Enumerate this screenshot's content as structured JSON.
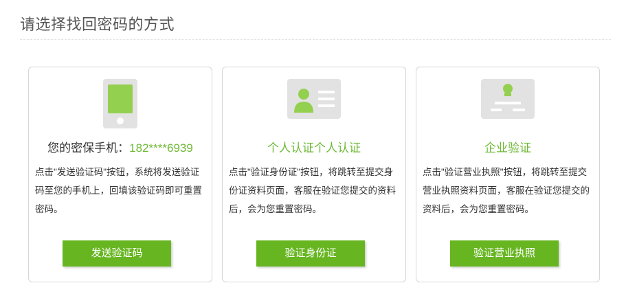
{
  "page": {
    "title": "请选择找回密码的方式"
  },
  "cards": [
    {
      "icon": "mobile-phone-icon",
      "heading_prefix": "您的密保手机：",
      "heading_value": "182****6939",
      "description": "点击\"发送验证码\"按钮，系统将发送验证码至您的手机上，回填该验证码即可重置密码。",
      "button_label": "发送验证码"
    },
    {
      "icon": "id-card-icon",
      "heading": "个人认证个人认证",
      "description": "点击\"验证身份证\"按钮，将跳转至提交身份证资料页面，客服在验证您提交的资料后，会为您重置密码。",
      "button_label": "验证身份证"
    },
    {
      "icon": "business-license-icon",
      "heading": "企业验证",
      "description": "点击\"验证营业执照\"按钮，将跳转至提交营业执照资料页面，客服在验证您提交的资料后，会为您重置密码。",
      "button_label": "验证营业执照"
    }
  ],
  "colors": {
    "accent_green": "#6eb935",
    "button_green": "#67b621",
    "icon_gray": "#e2e2e2",
    "icon_green": "#94d050"
  }
}
